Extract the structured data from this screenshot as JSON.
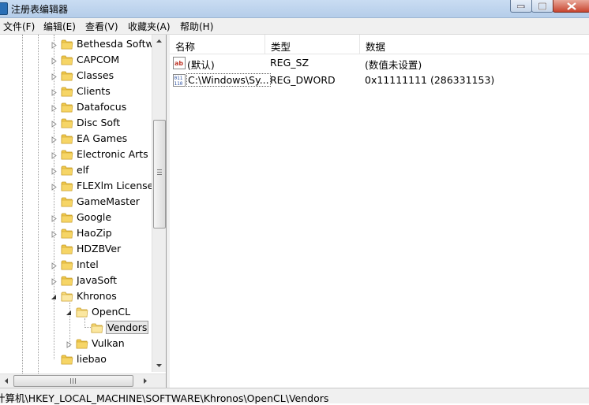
{
  "window": {
    "title": "注册表编辑器",
    "colors": {
      "titlebar": "#c9dcf2",
      "close_button": "#c8452f",
      "selection_border": "#9a9a9a"
    }
  },
  "menu": [
    {
      "label": "文件(F)"
    },
    {
      "label": "编辑(E)"
    },
    {
      "label": "查看(V)"
    },
    {
      "label": "收藏夹(A)"
    },
    {
      "label": "帮助(H)"
    }
  ],
  "tree": {
    "items": [
      {
        "label": "Bethesda Softwo",
        "expander": "collapsed"
      },
      {
        "label": "CAPCOM",
        "expander": "collapsed"
      },
      {
        "label": "Classes",
        "expander": "collapsed"
      },
      {
        "label": "Clients",
        "expander": "collapsed"
      },
      {
        "label": "Datafocus",
        "expander": "collapsed"
      },
      {
        "label": "Disc Soft",
        "expander": "collapsed"
      },
      {
        "label": "EA Games",
        "expander": "collapsed"
      },
      {
        "label": "Electronic Arts",
        "expander": "collapsed"
      },
      {
        "label": "elf",
        "expander": "collapsed"
      },
      {
        "label": "FLEXlm License I",
        "expander": "collapsed"
      },
      {
        "label": "GameMaster",
        "expander": "none"
      },
      {
        "label": "Google",
        "expander": "collapsed"
      },
      {
        "label": "HaoZip",
        "expander": "collapsed"
      },
      {
        "label": "HDZBVer",
        "expander": "none"
      },
      {
        "label": "Intel",
        "expander": "collapsed"
      },
      {
        "label": "JavaSoft",
        "expander": "collapsed"
      },
      {
        "label": "Khronos",
        "expander": "expanded"
      },
      {
        "label": "OpenCL",
        "expander": "expanded"
      },
      {
        "label": "Vendors",
        "expander": "none",
        "selected": true
      },
      {
        "label": "Vulkan",
        "expander": "collapsed"
      },
      {
        "label": "liebao",
        "expander": "none"
      }
    ]
  },
  "list": {
    "columns": [
      "名称",
      "类型",
      "数据"
    ],
    "rows": [
      {
        "icon": "string-value-icon",
        "name": "(默认)",
        "type": "REG_SZ",
        "data": "(数值未设置)"
      },
      {
        "icon": "binary-value-icon",
        "name": "C:\\Windows\\Sy...",
        "type": "REG_DWORD",
        "data": "0x11111111 (286331153)"
      }
    ]
  },
  "status": {
    "path": "计算机\\HKEY_LOCAL_MACHINE\\SOFTWARE\\Khronos\\OpenCL\\Vendors"
  }
}
